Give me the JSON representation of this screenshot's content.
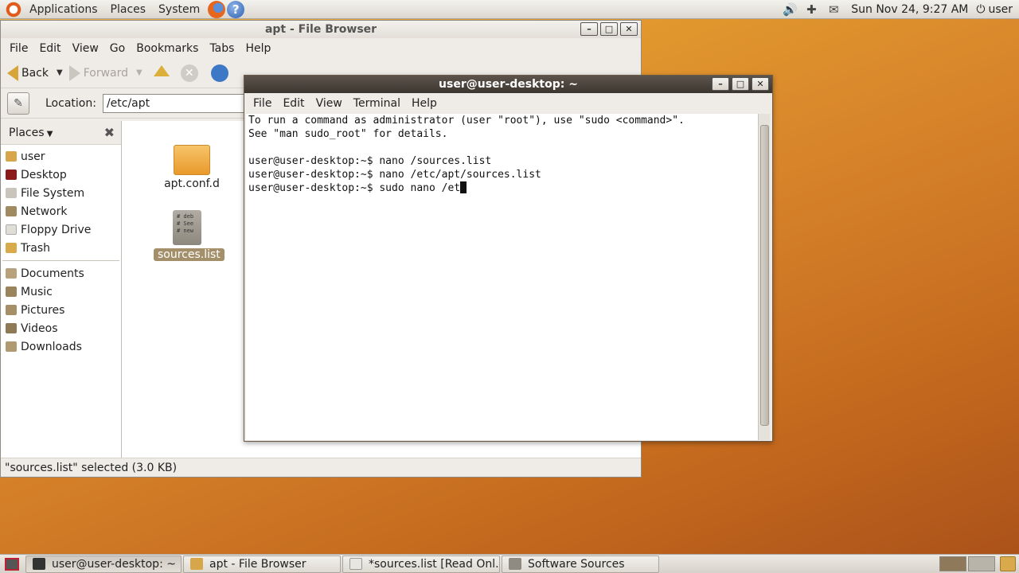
{
  "top_panel": {
    "menus": [
      "Applications",
      "Places",
      "System"
    ],
    "clock": "Sun Nov 24,  9:27 AM",
    "user": "user"
  },
  "file_browser": {
    "title": "apt - File Browser",
    "menu": [
      "File",
      "Edit",
      "View",
      "Go",
      "Bookmarks",
      "Tabs",
      "Help"
    ],
    "toolbar": {
      "back": "Back",
      "forward": "Forward"
    },
    "location_label": "Location:",
    "location_value": "/etc/apt",
    "sidebar_title": "Places",
    "places": [
      "user",
      "Desktop",
      "File System",
      "Network",
      "Floppy Drive",
      "Trash"
    ],
    "bookmarks": [
      "Documents",
      "Music",
      "Pictures",
      "Videos",
      "Downloads"
    ],
    "files": [
      "apt.conf.d",
      "sources.list"
    ],
    "doc_preview": [
      "# deb",
      "# See",
      "# new"
    ],
    "status": "\"sources.list\" selected (3.0 KB)"
  },
  "terminal": {
    "title": "user@user-desktop: ~",
    "menu": [
      "File",
      "Edit",
      "View",
      "Terminal",
      "Help"
    ],
    "lines": [
      "To run a command as administrator (user \"root\"), use \"sudo <command>\".",
      "See \"man sudo_root\" for details.",
      "",
      "user@user-desktop:~$ nano /sources.list",
      "user@user-desktop:~$ nano /etc/apt/sources.list",
      "user@user-desktop:~$ sudo nano /et"
    ]
  },
  "taskbar": {
    "tasks": [
      "user@user-desktop: ~",
      "apt - File Browser",
      "*sources.list [Read Onl...",
      "Software Sources"
    ]
  },
  "colors": {
    "terminal_titlebar": "#4a423b",
    "selection": "#a3906b",
    "desktop": "#dc8a2c"
  }
}
